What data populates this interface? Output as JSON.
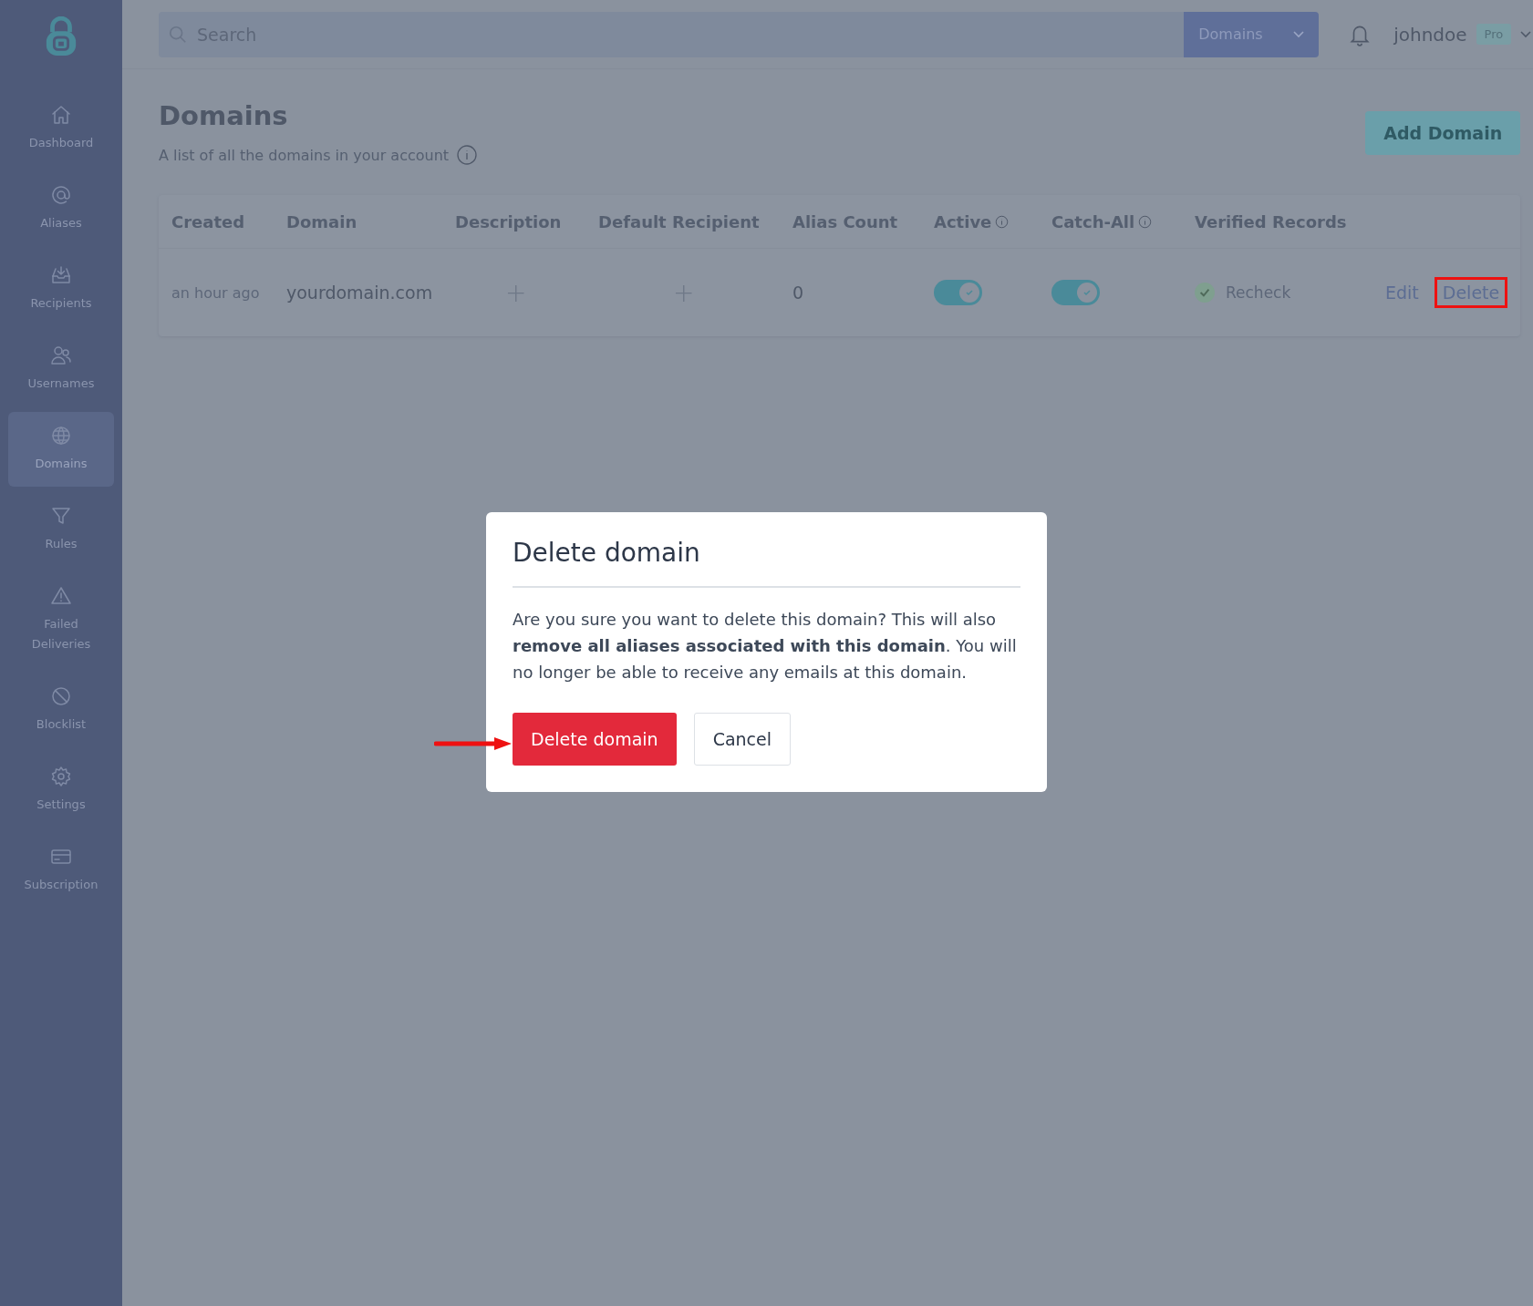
{
  "sidebar": {
    "items": [
      {
        "label": "Dashboard",
        "selected": false
      },
      {
        "label": "Aliases",
        "selected": false
      },
      {
        "label": "Recipients",
        "selected": false
      },
      {
        "label": "Usernames",
        "selected": false
      },
      {
        "label": "Domains",
        "selected": true
      },
      {
        "label": "Rules",
        "selected": false
      },
      {
        "label": "Failed Deliveries",
        "selected": false
      },
      {
        "label": "Blocklist",
        "selected": false
      },
      {
        "label": "Settings",
        "selected": false
      },
      {
        "label": "Subscription",
        "selected": false
      }
    ]
  },
  "topbar": {
    "search": {
      "placeholder": "Search"
    },
    "scope": "Domains",
    "username": "johndoe",
    "plan": "Pro"
  },
  "page": {
    "title": "Domains",
    "subtitle": "A list of all the domains in your account",
    "add_button": "Add Domain"
  },
  "table": {
    "columns": [
      {
        "label": "Created",
        "info": false
      },
      {
        "label": "Domain",
        "info": false
      },
      {
        "label": "Description",
        "info": false
      },
      {
        "label": "Default Recipient",
        "info": false
      },
      {
        "label": "Alias Count",
        "info": false
      },
      {
        "label": "Active",
        "info": true
      },
      {
        "label": "Catch-All",
        "info": true
      },
      {
        "label": "Verified Records",
        "info": false
      }
    ],
    "rows": [
      {
        "created": "an hour ago",
        "domain": "yourdomain.com",
        "description_add": "+",
        "recipient_add": "+",
        "alias_count": "0",
        "active": true,
        "catch_all": true,
        "verified": true,
        "recheck": "Recheck",
        "edit": "Edit",
        "delete": "Delete",
        "delete_highlighted": true
      }
    ]
  },
  "modal": {
    "title": "Delete domain",
    "body": "Are you sure you want to delete this domain? This will also **remove all aliases associated with this domain**. You will no longer be able to receive any emails at this domain.",
    "confirm": "Delete domain",
    "cancel": "Cancel",
    "confirm_pointed": true
  }
}
